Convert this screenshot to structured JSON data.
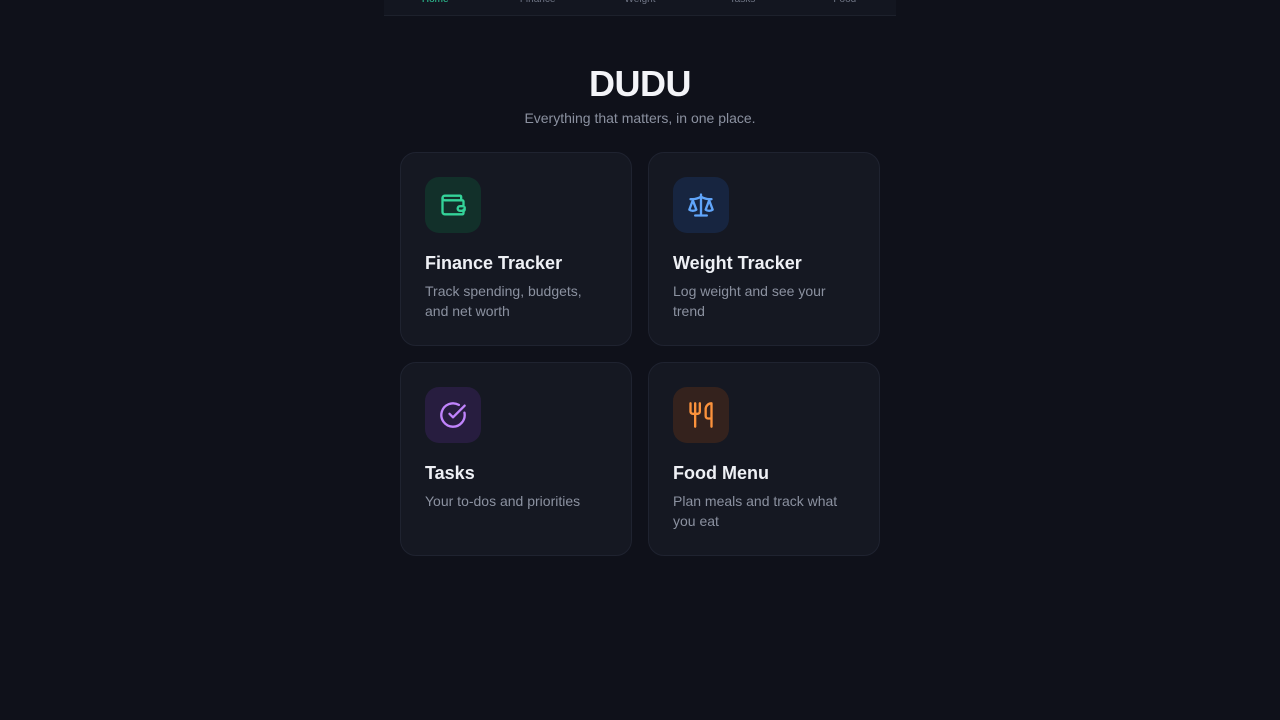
{
  "nav": {
    "items": [
      {
        "label": "Home",
        "active": true
      },
      {
        "label": "Finance",
        "active": false
      },
      {
        "label": "Weight",
        "active": false
      },
      {
        "label": "Tasks",
        "active": false
      },
      {
        "label": "Food",
        "active": false
      }
    ],
    "active_color": "#2ecc9a"
  },
  "hero": {
    "title": "DUDU",
    "subtitle": "Everything that matters, in one place."
  },
  "cards": [
    {
      "title": "Finance Tracker",
      "description": "Track spending, budgets, and net worth",
      "icon": "wallet-icon",
      "accent": "#34d399",
      "tile_bg": "#12302a"
    },
    {
      "title": "Weight Tracker",
      "description": "Log weight and see your trend",
      "icon": "scale-icon",
      "accent": "#60a5fa",
      "tile_bg": "#172540"
    },
    {
      "title": "Tasks",
      "description": "Your to-dos and priorities",
      "icon": "check-circle-icon",
      "accent": "#c084fc",
      "tile_bg": "#271d3f"
    },
    {
      "title": "Food Menu",
      "description": "Plan meals and track what you eat",
      "icon": "utensils-icon",
      "accent": "#fb923c",
      "tile_bg": "#34221d"
    }
  ]
}
